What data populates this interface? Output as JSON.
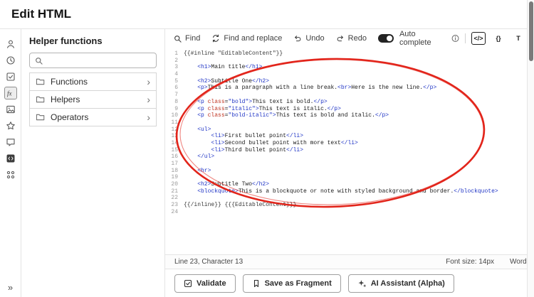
{
  "header": {
    "title": "Edit HTML"
  },
  "rail": {
    "collapse_label": "»",
    "icons": [
      "user",
      "history",
      "tasks",
      "helper-functions",
      "images",
      "favorites",
      "comments",
      "code-block",
      "components"
    ],
    "active_icon": "helper-functions"
  },
  "helper_panel": {
    "title": "Helper functions",
    "search_value": "",
    "groups": [
      "Functions",
      "Helpers",
      "Operators"
    ]
  },
  "toolbar": {
    "find": "Find",
    "find_and_replace": "Find and replace",
    "undo": "Undo",
    "redo": "Redo",
    "auto_complete": "Auto complete",
    "modes": [
      "</>",
      "{}",
      "T"
    ]
  },
  "editor": {
    "lines": [
      [
        [
          "hb",
          "{{#inline \"EditableContent\"}}"
        ]
      ],
      [],
      [
        [
          "txt",
          "    "
        ],
        [
          "tag",
          "<h1>"
        ],
        [
          "txt",
          "Main title"
        ],
        [
          "tag",
          "</h1>"
        ]
      ],
      [],
      [
        [
          "txt",
          "    "
        ],
        [
          "tag",
          "<h2>"
        ],
        [
          "txt",
          "Subtitle One"
        ],
        [
          "tag",
          "</h2>"
        ]
      ],
      [
        [
          "txt",
          "    "
        ],
        [
          "tag",
          "<p>"
        ],
        [
          "txt",
          "This is a paragraph with a line break."
        ],
        [
          "tag",
          "<br>"
        ],
        [
          "txt",
          "Here is the new line."
        ],
        [
          "tag",
          "</p>"
        ]
      ],
      [],
      [
        [
          "txt",
          "    "
        ],
        [
          "tag",
          "<p"
        ],
        [
          "attr",
          " class"
        ],
        [
          "txt",
          "="
        ],
        [
          "str",
          "\"bold\""
        ],
        [
          "tag",
          ">"
        ],
        [
          "txt",
          "This text is bold."
        ],
        [
          "tag",
          "</p>"
        ]
      ],
      [
        [
          "txt",
          "    "
        ],
        [
          "tag",
          "<p"
        ],
        [
          "attr",
          " class"
        ],
        [
          "txt",
          "="
        ],
        [
          "str",
          "\"italic\""
        ],
        [
          "tag",
          ">"
        ],
        [
          "txt",
          "This text is italic."
        ],
        [
          "tag",
          "</p>"
        ]
      ],
      [
        [
          "txt",
          "    "
        ],
        [
          "tag",
          "<p"
        ],
        [
          "attr",
          " class"
        ],
        [
          "txt",
          "="
        ],
        [
          "str",
          "\"bold-italic\""
        ],
        [
          "tag",
          ">"
        ],
        [
          "txt",
          "This text is bold and italic."
        ],
        [
          "tag",
          "</p>"
        ]
      ],
      [],
      [
        [
          "txt",
          "    "
        ],
        [
          "tag",
          "<ul>"
        ]
      ],
      [
        [
          "txt",
          "        "
        ],
        [
          "tag",
          "<li>"
        ],
        [
          "txt",
          "First bullet point"
        ],
        [
          "tag",
          "</li>"
        ]
      ],
      [
        [
          "txt",
          "        "
        ],
        [
          "tag",
          "<li>"
        ],
        [
          "txt",
          "Second bullet point with more text"
        ],
        [
          "tag",
          "</li>"
        ]
      ],
      [
        [
          "txt",
          "        "
        ],
        [
          "tag",
          "<li>"
        ],
        [
          "txt",
          "Third bullet point"
        ],
        [
          "tag",
          "</li>"
        ]
      ],
      [
        [
          "txt",
          "    "
        ],
        [
          "tag",
          "</ul>"
        ]
      ],
      [],
      [
        [
          "txt",
          "    "
        ],
        [
          "tag",
          "<hr>"
        ]
      ],
      [],
      [
        [
          "txt",
          "    "
        ],
        [
          "tag",
          "<h2>"
        ],
        [
          "txt",
          "Subtitle Two"
        ],
        [
          "tag",
          "</h2>"
        ]
      ],
      [
        [
          "txt",
          "    "
        ],
        [
          "tag",
          "<blockquote>"
        ],
        [
          "txt",
          "This is a blockquote or note with styled background and border."
        ],
        [
          "tag",
          "</blockquote>"
        ]
      ],
      [],
      [
        [
          "hb",
          "{{/inline}} {{{EditableContent}}}"
        ]
      ],
      []
    ]
  },
  "status_bar": {
    "line_info": "Line 23, Character 13",
    "font_size": "Font size: 14px",
    "word_wrap": "Word wrap"
  },
  "actions": {
    "validate": "Validate",
    "save_fragment": "Save as Fragment",
    "ai_assistant": "AI Assistant (Alpha)"
  },
  "annotation": {
    "type": "hand-drawn-red-ellipse",
    "color": "#e2251b"
  }
}
